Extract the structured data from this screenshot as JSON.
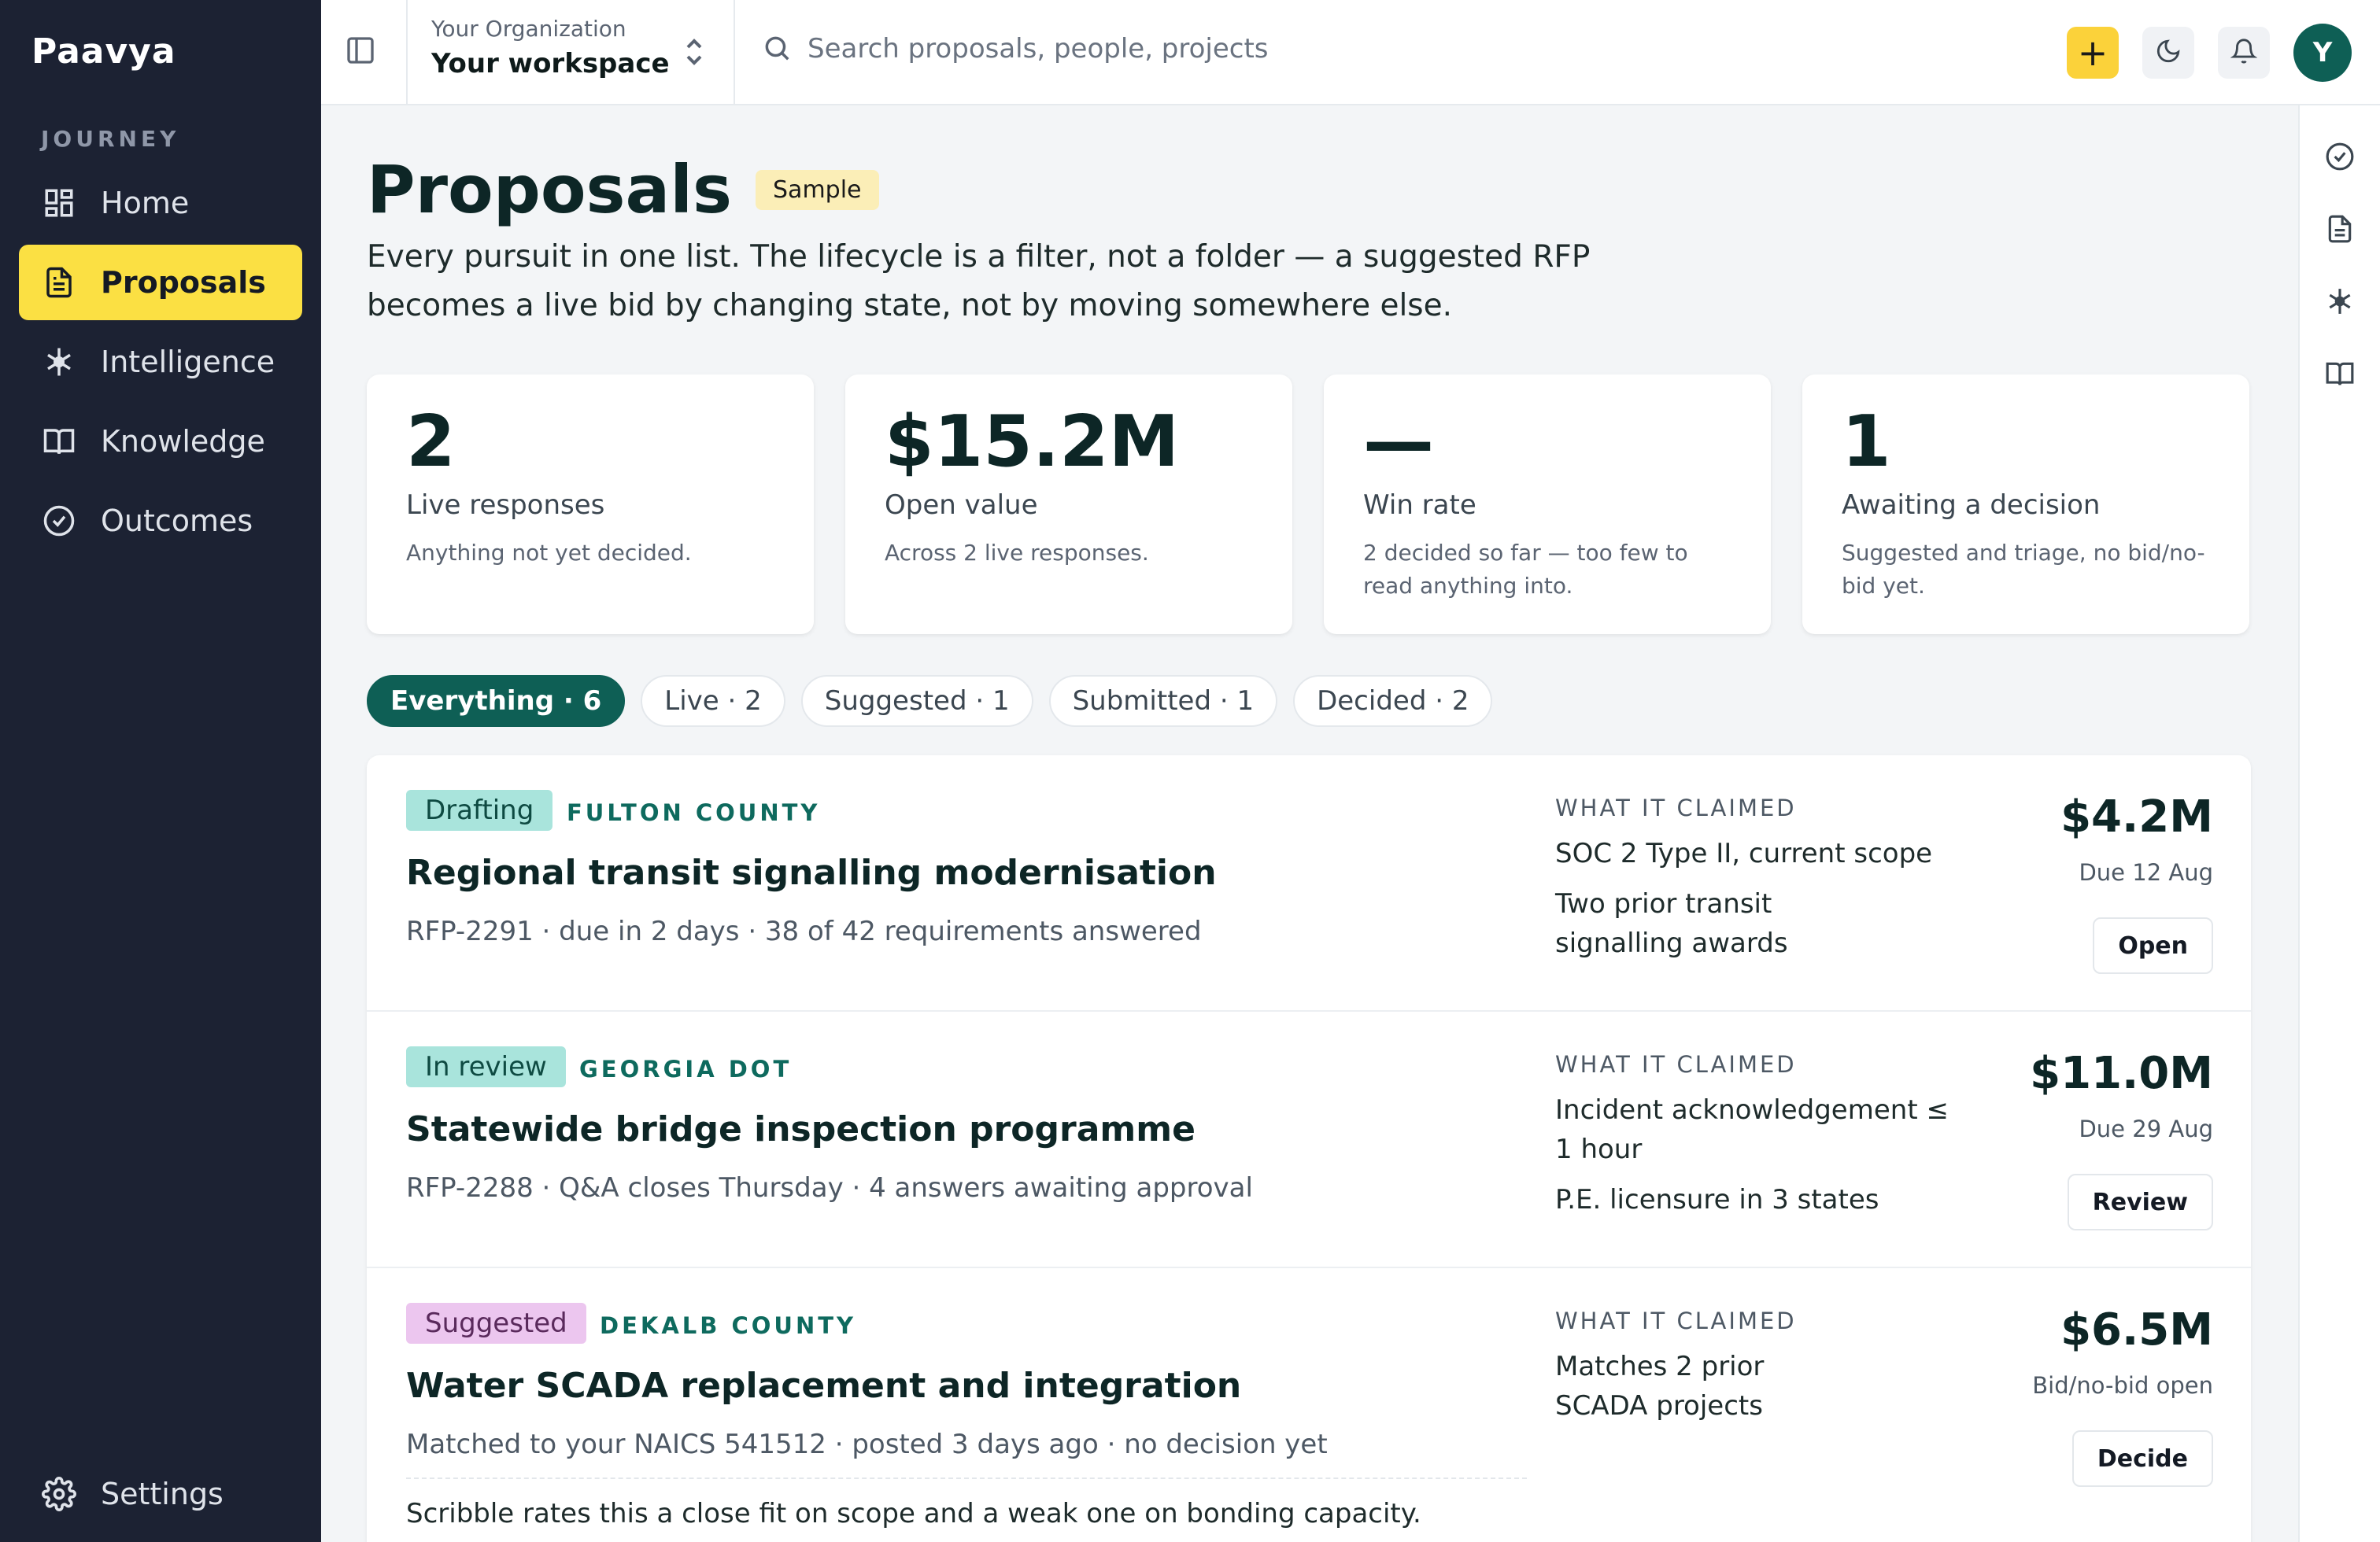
{
  "app": {
    "brand": "Paavya"
  },
  "sidebar": {
    "section": "JOURNEY",
    "items": [
      {
        "label": "Home",
        "icon": "grid-icon"
      },
      {
        "label": "Proposals",
        "icon": "document-icon",
        "active": true
      },
      {
        "label": "Intelligence",
        "icon": "sparkle-icon"
      },
      {
        "label": "Knowledge",
        "icon": "book-icon"
      },
      {
        "label": "Outcomes",
        "icon": "check-circle-icon"
      }
    ],
    "settings": "Settings"
  },
  "topbar": {
    "org_label": "Your Organization",
    "org_name": "Your workspace",
    "search_placeholder": "Search proposals, people, projects",
    "add_label": "+",
    "avatar_initial": "Y"
  },
  "page": {
    "title": "Proposals",
    "badge": "Sample",
    "subtitle_line1": "Every pursuit in one list. The lifecycle is a filter, not a folder — a suggested RFP",
    "subtitle_line2": "becomes a live bid by changing state, not by moving somewhere else."
  },
  "stats": [
    {
      "value": "2",
      "label": "Live responses",
      "note": "Anything not yet decided."
    },
    {
      "value": "$15.2M",
      "label": "Open value",
      "note": "Across 2 live responses."
    },
    {
      "value": "—",
      "label": "Win rate",
      "note": "2 decided so far — too few to read anything into."
    },
    {
      "value": "1",
      "label": "Awaiting a decision",
      "note": "Suggested and triage, no bid/no-bid yet."
    }
  ],
  "filters": [
    {
      "label": "Everything · 6",
      "active": true
    },
    {
      "label": "Live · 2"
    },
    {
      "label": "Suggested · 1"
    },
    {
      "label": "Submitted · 1"
    },
    {
      "label": "Decided · 2"
    }
  ],
  "claim_heading": "WHAT IT CLAIMED",
  "proposals": [
    {
      "status": "Drafting",
      "agency": "FULTON COUNTY",
      "title": "Regional transit signalling modernisation",
      "meta": "RFP-2291 · due in 2 days · 38 of 42 requirements answered",
      "claims": [
        "SOC 2 Type II, current scope",
        "Two prior transit signalling awards"
      ],
      "amount": "$4.2M",
      "due": "Due 12 Aug",
      "action": "Open"
    },
    {
      "status": "In review",
      "agency": "GEORGIA DOT",
      "title": "Statewide bridge inspection programme",
      "meta": "RFP-2288 · Q&A closes Thursday · 4 answers awaiting approval",
      "claims": [
        "Incident acknowledgement ≤ 1 hour",
        "P.E. licensure in 3 states"
      ],
      "amount": "$11.0M",
      "due": "Due 29 Aug",
      "action": "Review"
    },
    {
      "status": "Suggested",
      "agency": "DEKALB COUNTY",
      "title": "Water SCADA replacement and integration",
      "meta": "Matched to your NAICS 541512 · posted 3 days ago · no decision yet",
      "note": "Scribble rates this a close fit on scope and a weak one on bonding capacity.",
      "claims": [
        "Matches 2 prior SCADA projects"
      ],
      "amount": "$6.5M",
      "due": "Bid/no-bid open",
      "action": "Decide"
    }
  ],
  "colors": {
    "accent": "#0e5f55",
    "highlight": "#fbe043",
    "sidebar": "#1c2233"
  }
}
